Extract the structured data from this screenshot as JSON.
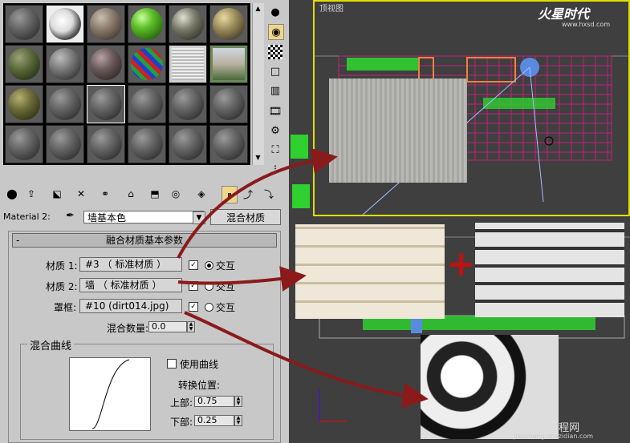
{
  "viewport": {
    "top_label": "顶视图",
    "logo_text": "火星时代",
    "logo_url": "www.hxsd.com"
  },
  "material_editor": {
    "material_label": "Material 2:",
    "material_name": "墙基本色",
    "material_type_button": "混合材质",
    "rollout_title": "融合材质基本参数",
    "rollout_toggle": "-",
    "material1": {
      "label": "材质 1:",
      "value": "#3 （ 标准材质 ）",
      "toggle_label": "交互",
      "checked": "✓"
    },
    "material2": {
      "label": "材质 2:",
      "value": "墙 （ 标准材质 ）",
      "toggle_label": "交互",
      "checked": "✓"
    },
    "mask": {
      "label": "罩框:",
      "value": "#10 (dirt014.jpg)",
      "toggle_label": "交互",
      "checked": "✓"
    },
    "mix_amount": {
      "label": "混合数量:",
      "value": "0.0"
    },
    "mix_curve": {
      "title": "混合曲线",
      "use_curve_label": "使用曲线",
      "transition_label": "转换位置:",
      "upper": {
        "label": "上部:",
        "value": "0.75"
      },
      "lower": {
        "label": "下部:",
        "value": "0.25"
      }
    }
  },
  "annotation": {
    "plus_sign": "+"
  },
  "watermark": {
    "text": "查字典 教程网",
    "sub": "jiaocheng.chazidian.com"
  },
  "colors": {
    "panel_bg": "#c8c8c8",
    "viewport_bg": "#3f3f3f",
    "active_viewport_border": "#e0e000",
    "arrow": "#8b1a1a",
    "grid": "#c0207a"
  }
}
